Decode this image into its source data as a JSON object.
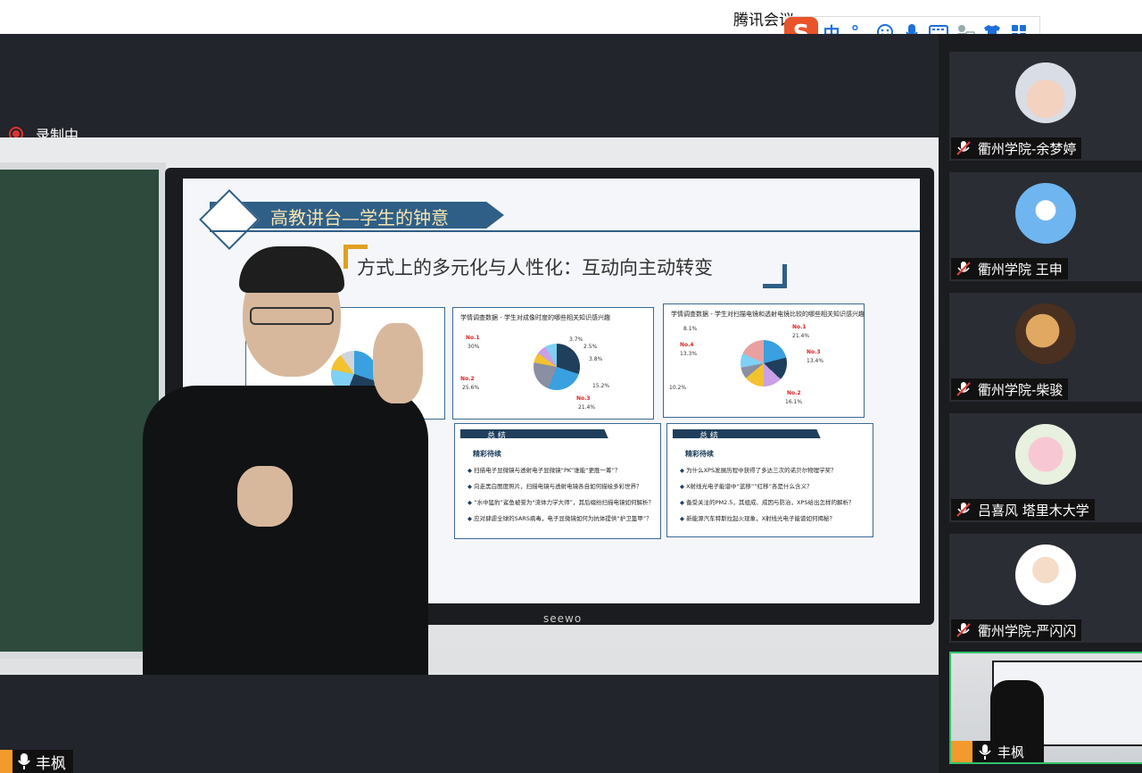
{
  "app": {
    "title": "腾讯会议"
  },
  "ime": {
    "logo": "S",
    "mode": "中",
    "punct": "°,",
    "items": [
      "smile-icon",
      "mic-icon",
      "keyboard-icon",
      "user-card-icon",
      "shirt-icon",
      "grid-icon"
    ]
  },
  "recording": {
    "status": "录制中"
  },
  "speaker": {
    "name": "丰枫"
  },
  "slide": {
    "title": "高教讲台—学生的钟意",
    "subtitle": "方式上的多元化与人性化：互动向主动转变",
    "panels": [
      {
        "title": "学情调查数据 - 学生对成像时度的哪些相关知识感兴趣",
        "stats": [
          "No.1",
          "30%",
          "No.2",
          "25.6%",
          "No.3",
          "21.4%",
          "3.7%",
          "2.5%",
          "3.8%",
          "15.2%"
        ]
      },
      {
        "title": "学情调查数据 - 学生对扫描电镜和透射电镜比较的哪些相关知识感兴趣",
        "stats": [
          "No.1",
          "21.4%",
          "No.2",
          "16.1%",
          "No.3",
          "13.4%",
          "No.4",
          "13.3%",
          "8.1%",
          "10.2%"
        ]
      }
    ],
    "summary_title": "总 结",
    "summary_sub": "精彩待续",
    "summary_left": [
      "扫描电子显微镜与透射电子显微镜“PK”谁能“更胜一筹”？",
      "向走黑白图度照片，扫描电镜与透射电镜各自如何描绘多彩世界？",
      "“水中猛豹”鲨鱼被誉为“流体力学大师”，其后缀纷扫描电镜如何解析？",
      "应对肆虐全球的SARS病毒，电子显微镜如何为抗体提供“护卫盔甲”？"
    ],
    "summary_right": [
      "为什么XPS发展历程中获得了多达三次的诺贝尔物理学奖？",
      "X射线光电子能谱中“蓝移”“红移”各是什么含义？",
      "备受关注的PM2.5，其组成、成因与防治，XPS给出怎样的解析？",
      "新能源汽车特斯拉起火现象，X射线光电子能谱如何揭秘？"
    ],
    "brand": "seewo"
  },
  "participants": [
    {
      "name": "衢州学院-余梦婷",
      "avatar": "baby-avatar"
    },
    {
      "name": "衢州学院 王申",
      "avatar": "sky-heart-avatar"
    },
    {
      "name": "衢州学院-柴骏",
      "avatar": "planet-avatar"
    },
    {
      "name": "吕喜风 塔里木大学",
      "avatar": "tulip-avatar"
    },
    {
      "name": "衢州学院-严闪闪",
      "avatar": "cartoon-man-avatar"
    }
  ],
  "self_view": {
    "name": "丰枫"
  },
  "colors": {
    "accent_green": "#2ec26a",
    "record_red": "#d33333",
    "slide_blue": "#2f5f87"
  }
}
